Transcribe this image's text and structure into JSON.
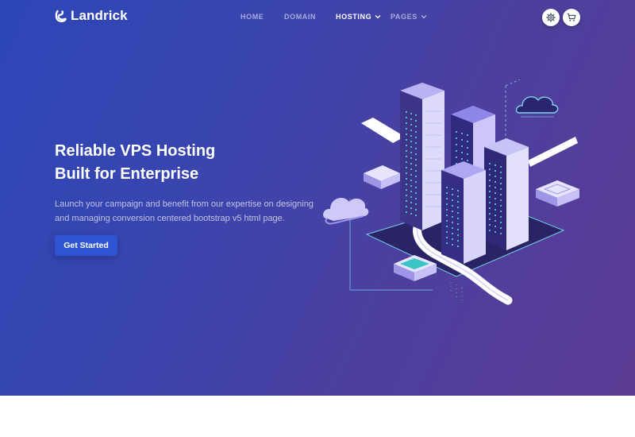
{
  "brand": {
    "name": "Landrick",
    "logo_icon": "landrick-logo-icon"
  },
  "nav": {
    "items": [
      {
        "label": "HOME",
        "active": false,
        "has_dropdown": false
      },
      {
        "label": "DOMAIN",
        "active": false,
        "has_dropdown": false
      },
      {
        "label": "HOSTING",
        "active": true,
        "has_dropdown": true
      },
      {
        "label": "PAGES",
        "active": false,
        "has_dropdown": true
      }
    ]
  },
  "header_actions": {
    "settings_icon": "gear-icon",
    "cart_icon": "cart-icon"
  },
  "hero": {
    "title_line1": "Reliable VPS Hosting",
    "title_line2": "Built for Enterprise",
    "description": "Launch your campaign and benefit from our expertise on designing and managing conversion centered bootstrap v5 html page.",
    "cta_label": "Get Started"
  },
  "colors": {
    "gradient_start": "#2c46b8",
    "gradient_end": "#5c3d95",
    "button": "#2f55d4",
    "text": "#ffffff"
  }
}
